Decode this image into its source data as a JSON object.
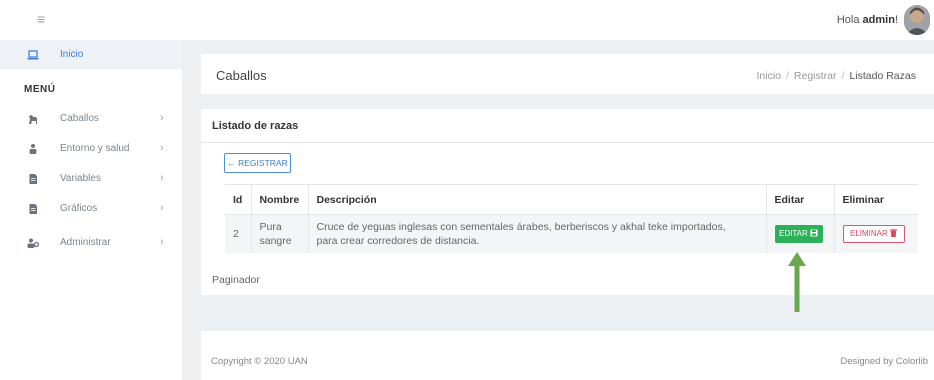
{
  "topbar": {
    "greeting_prefix": "Hola ",
    "user": "admin",
    "greeting_suffix": "!"
  },
  "sidebar": {
    "menu_title": "MENÚ",
    "home": {
      "label": "Inicio",
      "icon": "laptop-icon"
    },
    "items": [
      {
        "label": "Caballos",
        "icon": "horse-icon"
      },
      {
        "label": "Entorno y salud",
        "icon": "people-icon"
      },
      {
        "label": "Variables",
        "icon": "document-icon"
      },
      {
        "label": "Gráficos",
        "icon": "document-icon"
      },
      {
        "label": "Administrar",
        "icon": "users-cog-icon"
      }
    ],
    "chevron": "›"
  },
  "header": {
    "title": "Caballos",
    "breadcrumb": [
      "Inicio",
      "Registrar",
      "Listado Razas"
    ],
    "separator": "/"
  },
  "card": {
    "title": "Listado de razas",
    "register_button": "← REGISTRAR",
    "columns": [
      "Id",
      "Nombre",
      "Descripción",
      "Editar",
      "Eliminar"
    ],
    "rows": [
      {
        "id": "2",
        "nombre": "Pura sangre",
        "descripcion": "Cruce de yeguas inglesas con sementales árabes, berberiscos y akhal teke importados, para crear corredores de distancia.",
        "edit_label": "EDITAR",
        "delete_label": "ELIMINAR"
      }
    ],
    "paginator": "Paginador"
  },
  "footer": {
    "copyright": "Copyright © 2020 UAN",
    "designed": "Designed by Colorlib"
  },
  "colors": {
    "accent_blue": "#4a90d9",
    "edit_green": "#2db05a",
    "delete_red": "#e0556a",
    "annotation_arrow": "#6aa84f"
  }
}
